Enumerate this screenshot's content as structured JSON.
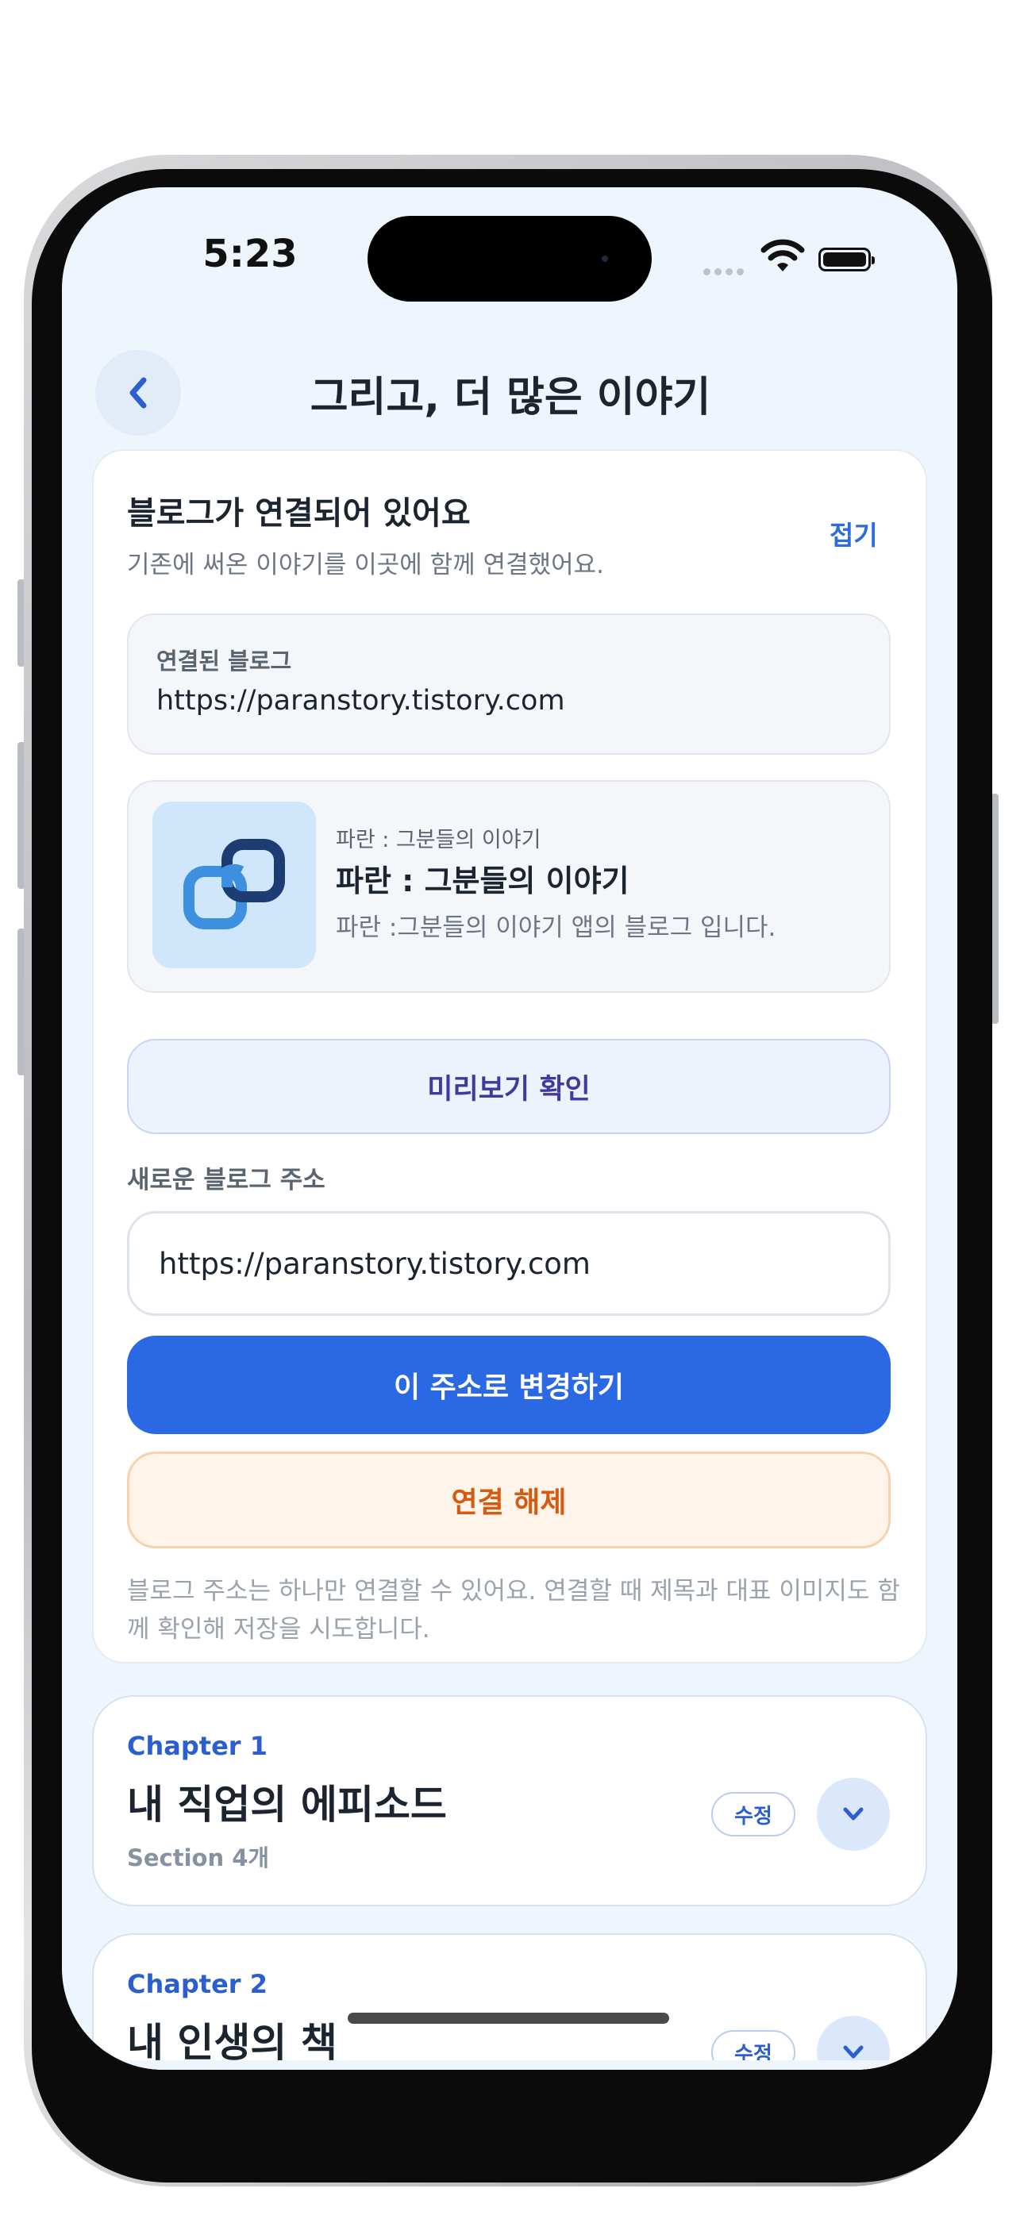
{
  "status_bar": {
    "time": "5:23"
  },
  "nav": {
    "title": "그리고, 더 많은 이야기",
    "back_icon": "chevron-left-icon"
  },
  "blog_section": {
    "title": "블로그가 연결되어 있어요",
    "subtitle": "기존에 써온 이야기를 이곳에 함께 연결했어요.",
    "fold_label": "접기",
    "linked_label": "연결된 블로그",
    "linked_url": "https://paranstory.tistory.com",
    "preview": {
      "site_name": "파란 : 그분들의 이야기",
      "title": "파란 : 그분들의 이야기",
      "description": "파란 :그분들의 이야기 앱의 블로그 입니다.",
      "thumbnail_icon": "link-chain-icon"
    },
    "preview_button": "미리보기 확인",
    "new_address_label": "새로운 블로그 주소",
    "new_address_value": "https://paranstory.tistory.com",
    "change_button": "이 주소로 변경하기",
    "disconnect_button": "연결 해제",
    "note": "블로그 주소는 하나만 연결할 수 있어요. 연결할 때 제목과 대표 이미지도 함께 확인해 저장을 시도합니다."
  },
  "chapters": [
    {
      "chapter": "Chapter 1",
      "title": "내 직업의 에피소드",
      "sections": "Section 4개",
      "edit_label": "수정"
    },
    {
      "chapter": "Chapter 2",
      "title": "내 인생의 책",
      "edit_label": "수정"
    }
  ],
  "colors": {
    "accent": "#2b68e4",
    "background": "#eff5fd",
    "danger_text": "#d65a10",
    "preview_text": "#3f3a9e"
  }
}
